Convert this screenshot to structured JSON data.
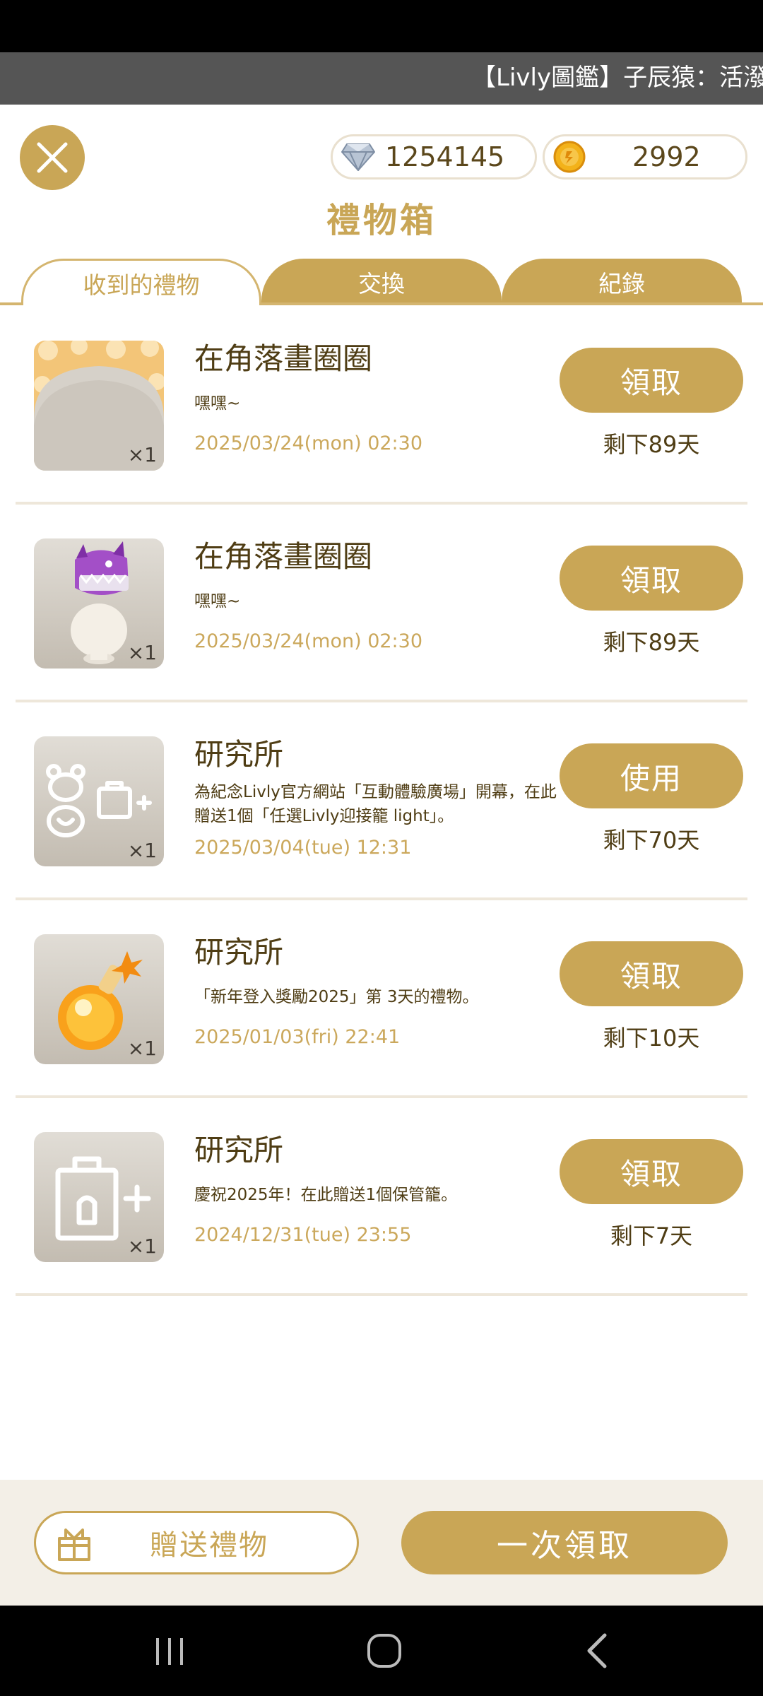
{
  "ticker": {
    "text": "【Livly圖鑑】子辰猿：活潑"
  },
  "currency": {
    "diamonds": "1254145",
    "coins": "2992"
  },
  "page_title": "禮物箱",
  "tabs": [
    {
      "label": "收到的禮物",
      "active": true
    },
    {
      "label": "交換",
      "active": false
    },
    {
      "label": "紀錄",
      "active": false
    }
  ],
  "gifts": [
    {
      "icon": "flower-background-item",
      "quantity": "×1",
      "title": "在角落畫圈圈",
      "message": "嘿嘿~",
      "date": "2025/03/24(mon) 02:30",
      "button": "領取",
      "remaining": "剩下89天"
    },
    {
      "icon": "purple-dragon-hat-item",
      "quantity": "×1",
      "title": "在角落畫圈圈",
      "message": "嘿嘿~",
      "date": "2025/03/24(mon) 02:30",
      "button": "領取",
      "remaining": "剩下89天"
    },
    {
      "icon": "livly-cage-plus-icon",
      "quantity": "×1",
      "title": "研究所",
      "message": "為紀念Livly官方網站「互動體驗廣場」開幕，在此贈送1個「任選Livly迎接籠 light」。",
      "date": "2025/03/04(tue) 12:31",
      "button": "使用",
      "remaining": "剩下70天"
    },
    {
      "icon": "orange-potion-item",
      "quantity": "×1",
      "title": "研究所",
      "message": "「新年登入獎勵2025」第 3天的禮物。",
      "date": "2025/01/03(fri) 22:41",
      "button": "領取",
      "remaining": "剩下10天"
    },
    {
      "icon": "storage-cage-plus-icon",
      "quantity": "×1",
      "title": "研究所",
      "message": "慶祝2025年！在此贈送1個保管籠。",
      "date": "2024/12/31(tue) 23:55",
      "button": "領取",
      "remaining": "剩下7天"
    }
  ],
  "bottom": {
    "send_label": "贈送禮物",
    "claim_all_label": "一次領取"
  },
  "colors": {
    "accent": "#c9a656",
    "text": "#4f3d14",
    "date": "#cba85c"
  }
}
